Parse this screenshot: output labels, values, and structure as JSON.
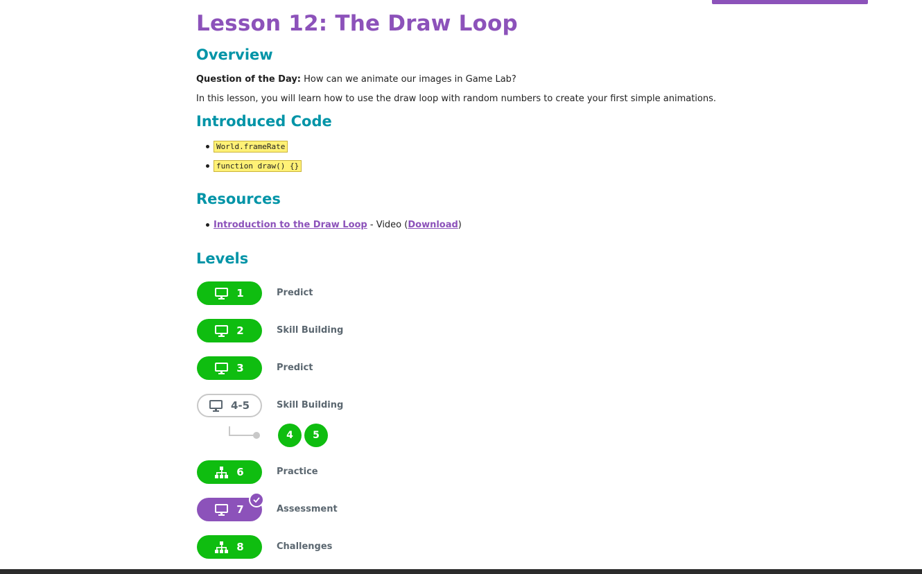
{
  "title": "Lesson 12: The Draw Loop",
  "overview": {
    "heading": "Overview",
    "qotd_label": "Question of the Day:",
    "qotd_text": " How can we animate our images in Game Lab?",
    "summary": "In this lesson, you will learn how to use the draw loop with random numbers to create your first simple animations."
  },
  "introduced_code": {
    "heading": "Introduced Code",
    "items": [
      "World.frameRate",
      "function draw() {}"
    ]
  },
  "resources": {
    "heading": "Resources",
    "items": [
      {
        "link": "Introduction to the Draw Loop",
        "suffix": " - Video (",
        "download": "Download",
        "close": ")"
      }
    ]
  },
  "levels": {
    "heading": "Levels",
    "items": [
      {
        "number": "1",
        "label": "Predict",
        "icon": "desktop-icon",
        "state": "complete"
      },
      {
        "number": "2",
        "label": "Skill Building",
        "icon": "desktop-icon",
        "state": "complete"
      },
      {
        "number": "3",
        "label": "Predict",
        "icon": "desktop-icon",
        "state": "complete"
      },
      {
        "number": "4-5",
        "label": "Skill Building",
        "icon": "desktop-icon",
        "state": "group",
        "sublevels": [
          "4",
          "5"
        ]
      },
      {
        "number": "6",
        "label": "Practice",
        "icon": "sitemap-icon",
        "state": "complete"
      },
      {
        "number": "7",
        "label": "Assessment",
        "icon": "desktop-icon",
        "state": "assessment-submitted"
      },
      {
        "number": "8",
        "label": "Challenges",
        "icon": "sitemap-icon",
        "state": "complete"
      }
    ]
  },
  "colors": {
    "title": "#8c52ba",
    "heading": "#0094a7",
    "complete": "#0fbd10",
    "assessment": "#8c52ba",
    "label": "#5b6770",
    "code_bg": "#fff176"
  }
}
